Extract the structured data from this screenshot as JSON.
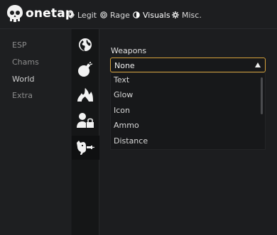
{
  "header": {
    "brand": "onetap",
    "tabs": [
      {
        "label": "Legit",
        "icon": "crosshair-icon"
      },
      {
        "label": "Rage",
        "icon": "target-icon"
      },
      {
        "label": "Visuals",
        "icon": "contrast-icon"
      },
      {
        "label": "Misc.",
        "icon": "gear-icon"
      }
    ],
    "active_tab": "Visuals"
  },
  "subnav": {
    "items": [
      "ESP",
      "Chams",
      "World",
      "Extra"
    ],
    "active": "World"
  },
  "icon_column": {
    "items": [
      "globe-icon",
      "grenade-icon",
      "fire-icon",
      "user-lock-icon",
      "dog-ray-icon"
    ],
    "active": "dog-ray-icon"
  },
  "content": {
    "field_label": "Weapons",
    "select": {
      "value": "None",
      "options": [
        "Text",
        "Glow",
        "Icon",
        "Ammo",
        "Distance"
      ]
    }
  },
  "colors": {
    "accent": "#d6a23b",
    "background": "#1a1b1d"
  }
}
